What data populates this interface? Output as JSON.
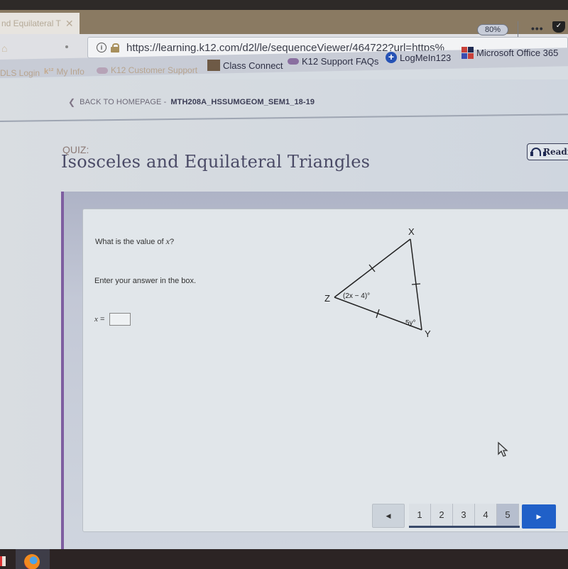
{
  "browser": {
    "tab_title": "nd Equilateral T",
    "tab_close": "✕",
    "url": "https://learning.k12.com/d2l/le/sequenceViewer/464722?url=https%",
    "zoom_level": "80%",
    "more_icon": "•••",
    "pocket_icon": "✓",
    "bookmarks": [
      {
        "label": "DLS Login"
      },
      {
        "label": "My Info",
        "prefix": "k¹²"
      },
      {
        "label": "K12 Customer Support"
      },
      {
        "label": "Class Connect"
      },
      {
        "label": "K12 Support FAQs"
      },
      {
        "label": "LogMeIn123"
      },
      {
        "label": "Microsoft Office 365"
      }
    ]
  },
  "page": {
    "back_link": {
      "chevron": "❮",
      "label": "BACK TO HOMEPAGE -",
      "course": "MTH208A_HSSUMGEOM_SEM1_18-19"
    },
    "quiz_label": "QUIZ:",
    "quiz_title": "Isosceles and Equilateral Triangles",
    "read_button": "Readi"
  },
  "question": {
    "prompt_prefix": "What is the value of ",
    "prompt_var": "x",
    "prompt_suffix": "?",
    "instruction": "Enter your answer in the box.",
    "answer_label_var": "x",
    "answer_label_eq": " =",
    "answer_value": ""
  },
  "diagram": {
    "vertices": {
      "X": "X",
      "Y": "Y",
      "Z": "Z"
    },
    "angle_z": "(2x − 4)°",
    "angle_y": "5y°"
  },
  "pagination": {
    "prev": "◀",
    "next": "▶",
    "pages": [
      "1",
      "2",
      "3",
      "4",
      "5"
    ],
    "current_page": "5"
  }
}
